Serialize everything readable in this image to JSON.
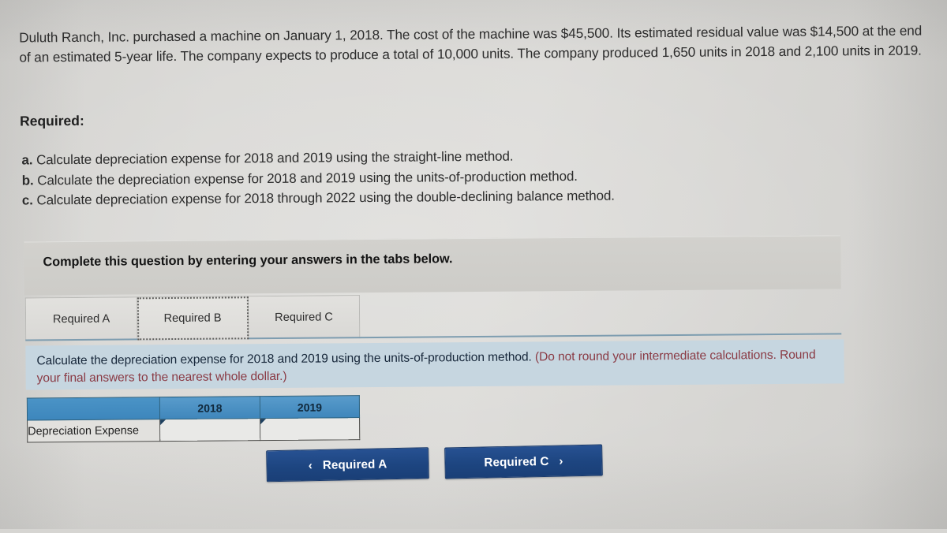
{
  "problem": {
    "statement": "Duluth Ranch, Inc. purchased a machine on January 1, 2018. The cost of the machine was $45,500. Its estimated residual value was $14,500 at the end of an estimated 5-year life. The company expects to produce a total of 10,000 units. The company produced 1,650 units in 2018 and 2,100 units in 2019."
  },
  "required": {
    "heading": "Required:",
    "items": [
      {
        "label": "a.",
        "text": "Calculate depreciation expense for 2018 and 2019 using the straight-line method."
      },
      {
        "label": "b.",
        "text": "Calculate the depreciation expense for 2018 and 2019 using the units-of-production method."
      },
      {
        "label": "c.",
        "text": "Calculate depreciation expense for 2018 through 2022 using the double-declining balance method."
      }
    ]
  },
  "banner": {
    "text": "Complete this question by entering your answers in the tabs below."
  },
  "tabs": [
    {
      "label": "Required A",
      "active": false
    },
    {
      "label": "Required B",
      "active": true
    },
    {
      "label": "Required C",
      "active": false
    }
  ],
  "instruction": {
    "main": "Calculate the depreciation expense for 2018 and 2019 using the units-of-production method.",
    "note": "(Do not round your intermediate calculations. Round your final answers to the nearest whole dollar.)"
  },
  "answer_table": {
    "columns": [
      "",
      "2018",
      "2019"
    ],
    "rows": [
      {
        "label": "Depreciation Expense",
        "values": [
          "",
          ""
        ]
      }
    ]
  },
  "navigation": {
    "prev_chevron": "‹",
    "prev_label": "Required A",
    "next_label": "Required C",
    "next_chevron": "›"
  },
  "colors": {
    "page_background": "#d6d5d2",
    "banner_background": "#cdccc8",
    "instruction_background": "#c6d6e0",
    "instruction_note": "#8a3a44",
    "table_header_blue": "#4a93c6",
    "button_blue": "#1d4580",
    "tab_underline": "#7e9db0"
  }
}
